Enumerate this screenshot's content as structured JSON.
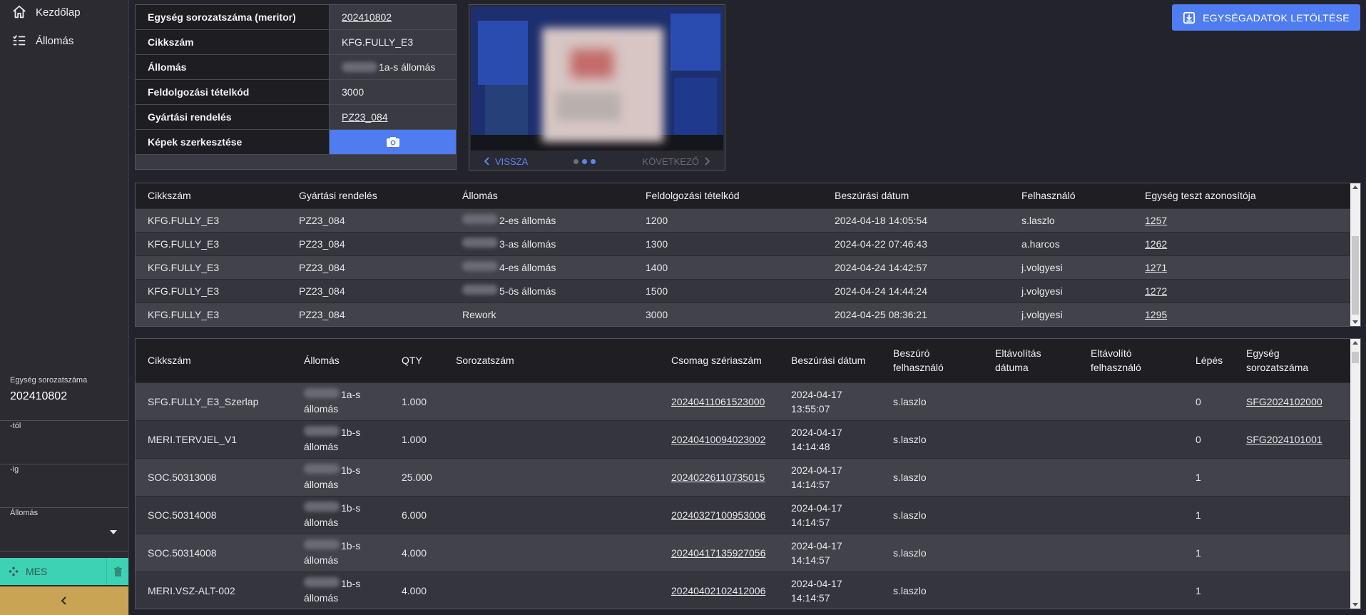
{
  "nav": {
    "home_label": "Kezdőlap",
    "station_label": "Állomás"
  },
  "filters": {
    "serial_label": "Egység sorozatszáma",
    "serial_value": "202410802",
    "from_label": "-tól",
    "to_label": "-ig",
    "station_label": "Állomás"
  },
  "mes": {
    "label": "MES"
  },
  "info": {
    "rows": [
      {
        "key": "Egység sorozatszáma (meritor)",
        "value": "202410802"
      },
      {
        "key": "Cikkszám",
        "value": "KFG.FULLY_E3"
      },
      {
        "key": "Állomás",
        "value": "1a-s állomás"
      },
      {
        "key": "Feldolgozási tételkód",
        "value": "3000"
      },
      {
        "key": "Gyártási rendelés",
        "value": "PZ23_084"
      },
      {
        "key": "Képek szerkesztése",
        "value": ""
      }
    ]
  },
  "carousel": {
    "prev_label": "VISSZA",
    "next_label": "KÖVETKEZŐ"
  },
  "download": {
    "label": "EGYSÉGADATOK LETÖLTÉSE"
  },
  "history": {
    "headers": [
      "Cikkszám",
      "Gyártási rendelés",
      "Állomás",
      "Feldolgozási tételkód",
      "Beszúrási dátum",
      "Felhasználó",
      "Egység teszt azonosítója"
    ],
    "rows": [
      {
        "part": "KFG.FULLY_E3",
        "order": "PZ23_084",
        "station": "2-es állomás",
        "code": "1200",
        "date": "2024-04-18 14:05:54",
        "user": "s.laszlo",
        "test_id": "1257"
      },
      {
        "part": "KFG.FULLY_E3",
        "order": "PZ23_084",
        "station": "3-as állomás",
        "code": "1300",
        "date": "2024-04-22 07:46:43",
        "user": "a.harcos",
        "test_id": "1262"
      },
      {
        "part": "KFG.FULLY_E3",
        "order": "PZ23_084",
        "station": "4-es állomás",
        "code": "1400",
        "date": "2024-04-24 14:42:57",
        "user": "j.volgyesi",
        "test_id": "1271"
      },
      {
        "part": "KFG.FULLY_E3",
        "order": "PZ23_084",
        "station": "5-ös állomás",
        "code": "1500",
        "date": "2024-04-24 14:44:24",
        "user": "j.volgyesi",
        "test_id": "1272"
      },
      {
        "part": "KFG.FULLY_E3",
        "order": "PZ23_084",
        "station": "Rework",
        "code": "3000",
        "date": "2024-04-25 08:36:21",
        "user": "j.volgyesi",
        "test_id": "1295"
      }
    ]
  },
  "components": {
    "headers": {
      "part": "Cikkszám",
      "station": "Állomás",
      "qty": "QTY",
      "serial": "Sorozatszám",
      "package": "Csomag szériaszám",
      "date": "Beszúrási dátum",
      "inserter_1": "Beszúró",
      "inserter_2": "felhasználó",
      "removal_1": "Eltávolítás",
      "removal_2": "dátuma",
      "remover_1": "Eltávolító",
      "remover_2": "felhasználó",
      "step": "Lépés",
      "unit_1": "Egység",
      "unit_2": "sorozatszáma"
    },
    "rows": [
      {
        "part": "SFG.FULLY_E3_Szerlap",
        "station_1": "1a-s",
        "station_2": "állomás",
        "qty": "1.000",
        "package": "20240411061523000",
        "date_1": "2024-04-17",
        "date_2": "13:55:07",
        "user": "s.laszlo",
        "step": "0",
        "unit": "SFG2024102000"
      },
      {
        "part": "MERI.TERVJEL_V1",
        "station_1": "1b-s",
        "station_2": "állomás",
        "qty": "1.000",
        "package": "20240410094023002",
        "date_1": "2024-04-17",
        "date_2": "14:14:48",
        "user": "s.laszlo",
        "step": "0",
        "unit": "SFG2024101001"
      },
      {
        "part": "SOC.50313008",
        "station_1": "1b-s",
        "station_2": "állomás",
        "qty": "25.000",
        "package": "20240226110735015",
        "date_1": "2024-04-17",
        "date_2": "14:14:57",
        "user": "s.laszlo",
        "step": "1",
        "unit": ""
      },
      {
        "part": "SOC.50314008",
        "station_1": "1b-s",
        "station_2": "állomás",
        "qty": "6.000",
        "package": "20240327100953006",
        "date_1": "2024-04-17",
        "date_2": "14:14:57",
        "user": "s.laszlo",
        "step": "1",
        "unit": ""
      },
      {
        "part": "SOC.50314008",
        "station_1": "1b-s",
        "station_2": "állomás",
        "qty": "4.000",
        "package": "20240417135927056",
        "date_1": "2024-04-17",
        "date_2": "14:14:57",
        "user": "s.laszlo",
        "step": "1",
        "unit": ""
      },
      {
        "part": "MERI.VSZ-ALT-002",
        "station_1": "1b-s",
        "station_2": "állomás",
        "qty": "4.000",
        "package": "20240402102412006",
        "date_1": "2024-04-17",
        "date_2": "14:14:57",
        "user": "s.laszlo",
        "step": "1",
        "unit": ""
      }
    ]
  },
  "colors": {
    "accent": "#4f7cf0",
    "mes": "#3dd2b4",
    "collapse": "#c9a455"
  }
}
